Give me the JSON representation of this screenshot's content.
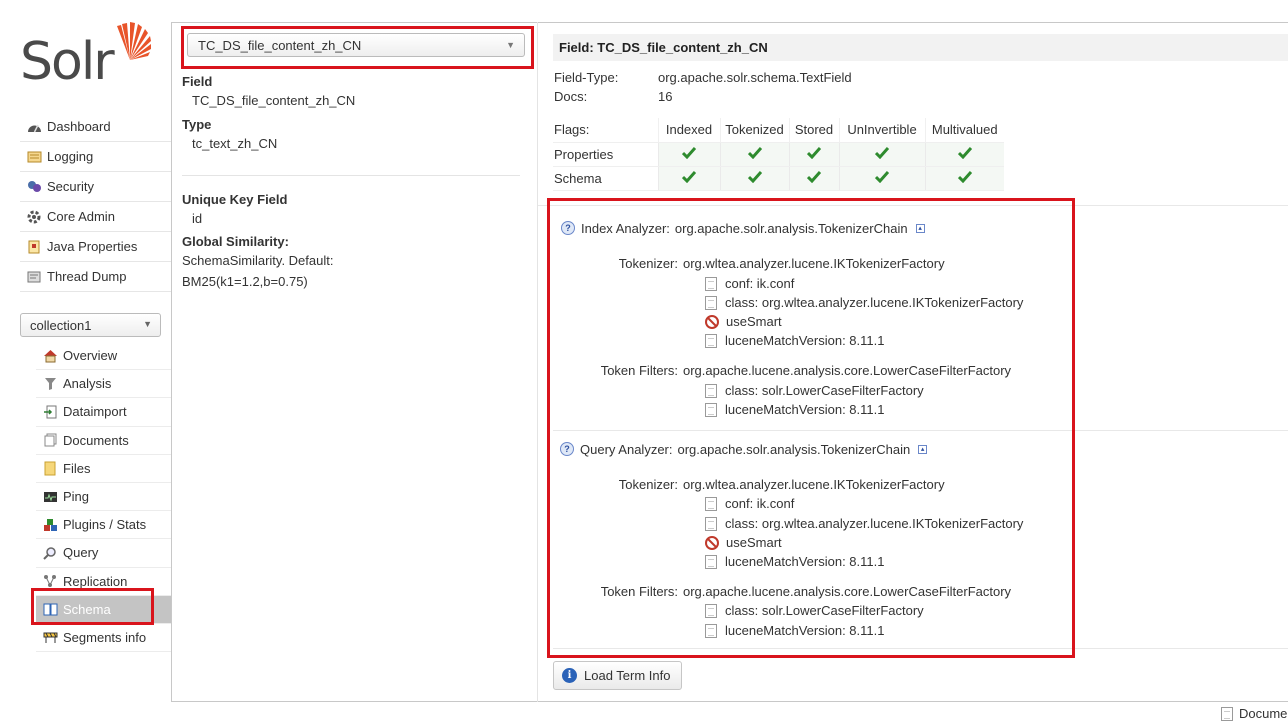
{
  "logo": {
    "text": "Solr"
  },
  "main_nav": [
    {
      "label": "Dashboard",
      "icon": "dashboard-icon"
    },
    {
      "label": "Logging",
      "icon": "logging-icon"
    },
    {
      "label": "Security",
      "icon": "security-icon"
    },
    {
      "label": "Core Admin",
      "icon": "core-admin-icon"
    },
    {
      "label": "Java Properties",
      "icon": "java-properties-icon"
    },
    {
      "label": "Thread Dump",
      "icon": "thread-dump-icon"
    }
  ],
  "core_selector": {
    "value": "collection1"
  },
  "core_nav": [
    {
      "label": "Overview",
      "icon": "home-icon"
    },
    {
      "label": "Analysis",
      "icon": "filter-icon"
    },
    {
      "label": "Dataimport",
      "icon": "import-icon"
    },
    {
      "label": "Documents",
      "icon": "documents-icon"
    },
    {
      "label": "Files",
      "icon": "folder-icon"
    },
    {
      "label": "Ping",
      "icon": "ping-icon"
    },
    {
      "label": "Plugins / Stats",
      "icon": "plugins-icon"
    },
    {
      "label": "Query",
      "icon": "magnifier-icon"
    },
    {
      "label": "Replication",
      "icon": "replication-icon"
    },
    {
      "label": "Schema",
      "icon": "book-icon",
      "active": true
    },
    {
      "label": "Segments info",
      "icon": "segments-icon"
    }
  ],
  "field_select": {
    "value": "TC_DS_file_content_zh_CN"
  },
  "left_info": {
    "field_label": "Field",
    "field_value": "TC_DS_file_content_zh_CN",
    "type_label": "Type",
    "type_value": "tc_text_zh_CN",
    "unique_key_label": "Unique Key Field",
    "unique_key_value": "id",
    "similarity_label": "Global Similarity:",
    "similarity_line1": "SchemaSimilarity. Default:",
    "similarity_line2": "BM25(k1=1.2,b=0.75)"
  },
  "detail": {
    "header": "Field: TC_DS_file_content_zh_CN",
    "field_type_label": "Field-Type:",
    "field_type_value": "org.apache.solr.schema.TextField",
    "docs_label": "Docs:",
    "docs_value": "16"
  },
  "flags": {
    "label": "Flags:",
    "columns": [
      "Indexed",
      "Tokenized",
      "Stored",
      "UnInvertible",
      "Multivalued"
    ],
    "rows": [
      {
        "label": "Properties",
        "values": [
          true,
          true,
          true,
          true,
          true
        ]
      },
      {
        "label": "Schema",
        "values": [
          true,
          true,
          true,
          true,
          true
        ]
      }
    ]
  },
  "index_analyzer": {
    "title_prefix": "Index Analyzer:",
    "title_value": "org.apache.solr.analysis.TokenizerChain",
    "tokenizer_label": "Tokenizer:",
    "tokenizer_value": "org.wltea.analyzer.lucene.IKTokenizerFactory",
    "tokenizer_args": [
      "conf: ik.conf",
      "class: org.wltea.analyzer.lucene.IKTokenizerFactory",
      "useSmart",
      "luceneMatchVersion: 8.11.1"
    ],
    "filters_label": "Token Filters:",
    "filters_value": "org.apache.lucene.analysis.core.LowerCaseFilterFactory",
    "filter_args": [
      "class: solr.LowerCaseFilterFactory",
      "luceneMatchVersion: 8.11.1"
    ]
  },
  "query_analyzer": {
    "title_prefix": "Query Analyzer:",
    "title_value": "org.apache.solr.analysis.TokenizerChain",
    "tokenizer_label": "Tokenizer:",
    "tokenizer_value": "org.wltea.analyzer.lucene.IKTokenizerFactory",
    "tokenizer_args": [
      "conf: ik.conf",
      "class: org.wltea.analyzer.lucene.IKTokenizerFactory",
      "useSmart",
      "luceneMatchVersion: 8.11.1"
    ],
    "filters_label": "Token Filters:",
    "filters_value": "org.apache.lucene.analysis.core.LowerCaseFilterFactory",
    "filter_args": [
      "class: solr.LowerCaseFilterFactory",
      "luceneMatchVersion: 8.11.1"
    ]
  },
  "load_button": {
    "label": "Load Term Info"
  },
  "footer": {
    "documentation": "Documentation"
  },
  "colors": {
    "highlight_red": "#d9141c",
    "check_green": "#2e8b2e",
    "active_nav": "#c4c4c4"
  }
}
